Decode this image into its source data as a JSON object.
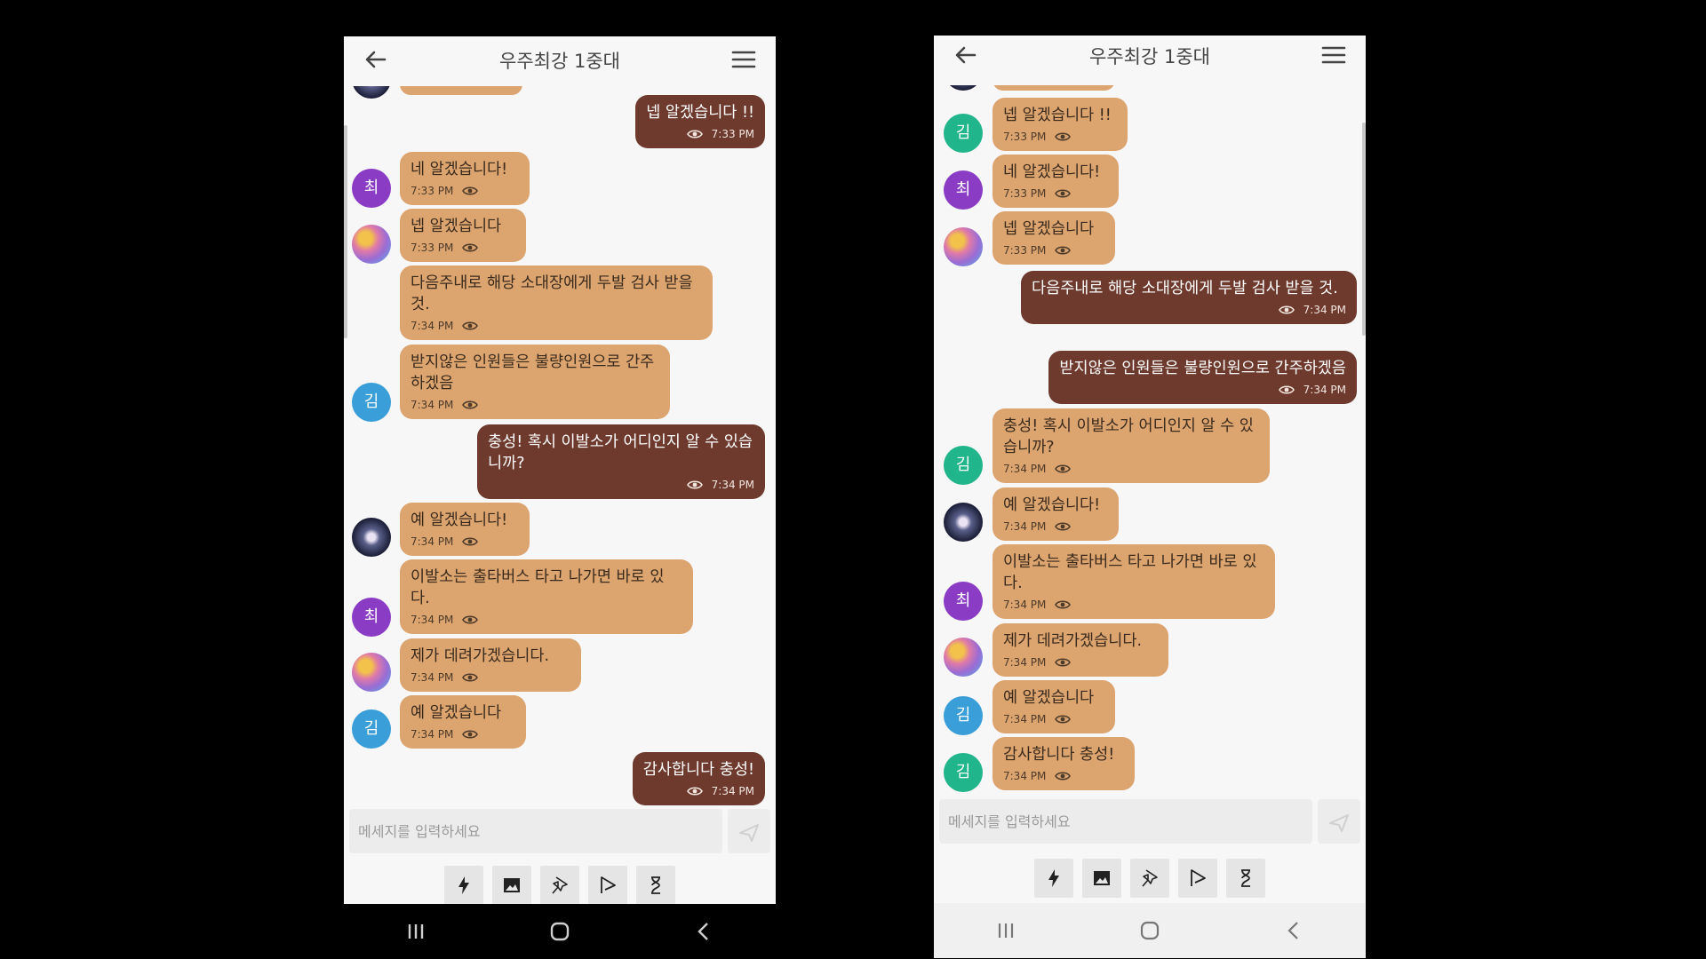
{
  "left": {
    "title": "우주최강 1중대",
    "input_placeholder": "메세지를 입력하세요",
    "messages": [
      {
        "text": "넵 알겠습니다 !!",
        "time": "7:33 PM"
      },
      {
        "text": "네 알겠습니다!",
        "time": "7:33 PM",
        "avatar": "최"
      },
      {
        "text": "넵 알겠습니다",
        "time": "7:33 PM"
      },
      {
        "text": "다음주내로 해당 소대장에게 두발 검사 받을 것.",
        "time": "7:34 PM"
      },
      {
        "text": "받지않은 인원들은 불량인원으로 간주하겠음",
        "time": "7:34 PM",
        "avatar": "김"
      },
      {
        "text": "충성! 혹시 이발소가 어디인지 알 수 있습니까?",
        "time": "7:34 PM"
      },
      {
        "text": "예 알겠습니다!",
        "time": "7:34 PM"
      },
      {
        "text": "이발소는 출타버스 타고 나가면 바로 있다.",
        "time": "7:34 PM",
        "avatar": "최"
      },
      {
        "text": "제가 데려가겠습니다.",
        "time": "7:34 PM"
      },
      {
        "text": "예 알겠습니다",
        "time": "7:34 PM",
        "avatar": "김"
      },
      {
        "text": "감사합니다 충성!",
        "time": "7:34 PM"
      }
    ]
  },
  "right": {
    "title": "우주최강 1중대",
    "input_placeholder": "메세지를 입력하세요",
    "messages": [
      {
        "text": "넵 알겠습니다 !!",
        "time": "7:33 PM",
        "avatar": "김"
      },
      {
        "text": "네 알겠습니다!",
        "time": "7:33 PM",
        "avatar": "최"
      },
      {
        "text": "넵 알겠습니다",
        "time": "7:33 PM"
      },
      {
        "text": "다음주내로 해당 소대장에게 두발 검사 받을 것.",
        "time": "7:34 PM"
      },
      {
        "text": "받지않은 인원들은 불량인원으로 간주하겠음",
        "time": "7:34 PM"
      },
      {
        "text": "충성! 혹시 이발소가 어디인지 알 수 있습니까?",
        "time": "7:34 PM",
        "avatar": "김"
      },
      {
        "text": "예 알겠습니다!",
        "time": "7:34 PM"
      },
      {
        "text": "이발소는 출타버스 타고 나가면 바로 있다.",
        "time": "7:34 PM",
        "avatar": "최"
      },
      {
        "text": "제가 데려가겠습니다.",
        "time": "7:34 PM"
      },
      {
        "text": "예 알겠습니다",
        "time": "7:34 PM",
        "avatar": "김"
      },
      {
        "text": "감사합니다 충성!",
        "time": "7:34 PM",
        "avatar": "김"
      }
    ]
  },
  "toolbar_icons": [
    "lightning-icon",
    "image-icon",
    "pin-icon",
    "flag-icon",
    "hourglass-icon"
  ],
  "nav_icons": [
    "recent-apps-icon",
    "home-icon",
    "back-nav-icon"
  ],
  "colors": {
    "incoming_bubble": "#dca46f",
    "outgoing_bubble": "#6e3a2d",
    "avatar_purple": "#8b3cc4",
    "avatar_teal": "#20b58a",
    "avatar_blue": "#3a9ed8"
  }
}
